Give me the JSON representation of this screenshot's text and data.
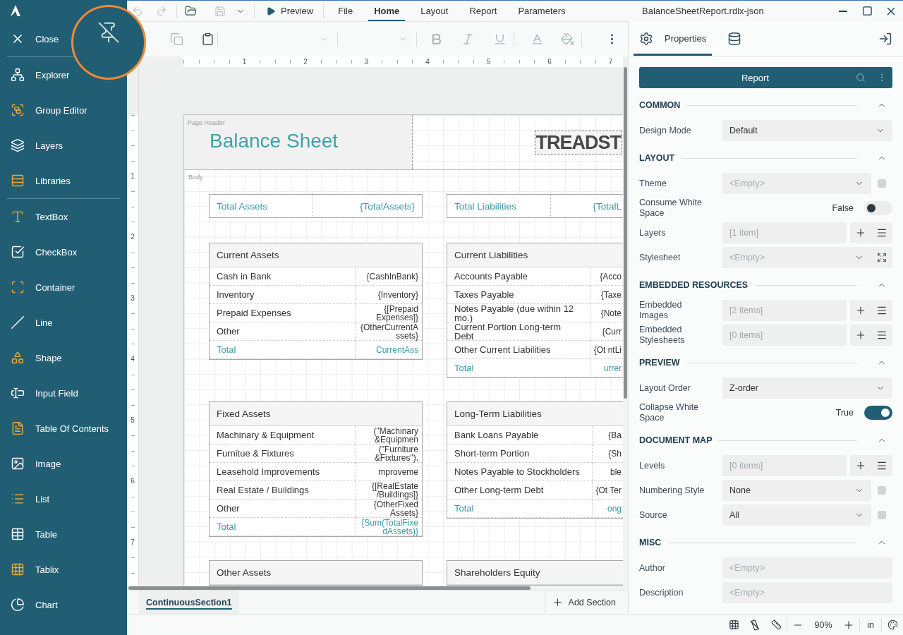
{
  "window": {
    "title": "BalanceSheetReport.rdlx-json"
  },
  "sidebar": {
    "close": "Close",
    "panels": [
      {
        "label": "Explorer"
      },
      {
        "label": "Group Editor"
      },
      {
        "label": "Layers"
      },
      {
        "label": "Libraries"
      }
    ],
    "tools": [
      {
        "label": "TextBox"
      },
      {
        "label": "CheckBox"
      },
      {
        "label": "Container"
      },
      {
        "label": "Line"
      },
      {
        "label": "Shape"
      },
      {
        "label": "Input Field"
      },
      {
        "label": "Table Of Contents"
      },
      {
        "label": "Image"
      },
      {
        "label": "List"
      },
      {
        "label": "Table"
      },
      {
        "label": "Tablix"
      },
      {
        "label": "Chart"
      }
    ]
  },
  "quick_actions": [
    {
      "disabled": true
    },
    {
      "disabled": true
    },
    {
      "disabled": false
    },
    {
      "disabled": true
    },
    {
      "disabled": false
    }
  ],
  "preview": "Preview",
  "menu_tabs": [
    {
      "label": "File",
      "selected": false
    },
    {
      "label": "Home",
      "selected": true
    },
    {
      "label": "Layout",
      "selected": false
    },
    {
      "label": "Report",
      "selected": false
    },
    {
      "label": "Parameters",
      "selected": false
    }
  ],
  "toolbar": [
    {
      "disabled": true
    },
    {
      "disabled": false
    },
    {
      "disabled": true
    },
    {
      "disabled": true
    },
    {
      "disabled": true
    },
    {
      "disabled": true
    },
    {
      "disabled": true
    },
    {
      "disabled": false
    }
  ],
  "ruler": {
    "horizontal": [
      "1",
      "2",
      "3",
      "4",
      "5",
      "6",
      "7"
    ],
    "vertical": [
      "1",
      "2",
      "3",
      "4",
      "5",
      "6",
      "7"
    ]
  },
  "report": {
    "page_header": {
      "label": "Page Header",
      "title": "Balance Sheet",
      "logo_text": "TREADST"
    },
    "body": {
      "label": "Body",
      "items": [
        {
          "kind": "summary",
          "label": "Total Assets",
          "value": "{TotalAssets}"
        },
        {
          "kind": "summary",
          "label": "Total Liabilities",
          "value": "{TotalL"
        },
        {
          "kind": "table",
          "title": "Current Assets",
          "rows": [
            {
              "kind": "item",
              "label": "Cash in Bank",
              "value": "{CashInBank}"
            },
            {
              "kind": "item",
              "label": "Inventory",
              "value": "{Inventory}"
            },
            {
              "kind": "item",
              "label": "Prepaid Expenses",
              "value": "{[Prepaid Expenses]}"
            },
            {
              "kind": "item",
              "label": "Other",
              "value": "{OtherCurrentAssets}"
            },
            {
              "kind": "total",
              "label": "Total",
              "value": "CurrentAss"
            }
          ]
        },
        {
          "kind": "table",
          "title": "Current Liabilities",
          "rows": [
            {
              "kind": "item",
              "label": "Accounts Payable",
              "value": "{Acco"
            },
            {
              "kind": "item",
              "label": "Taxes Payable",
              "value": "{Taxe"
            },
            {
              "kind": "item",
              "label": "Notes Payable (due within 12 mo.)",
              "value": "{Note"
            },
            {
              "kind": "item",
              "label": "Current Portion Long-term Debt",
              "value": "{Curr"
            },
            {
              "kind": "item",
              "label": "Other Current Liabilities",
              "value": "{Ot ntLi"
            },
            {
              "kind": "total",
              "label": "Total",
              "value": "urrer"
            }
          ]
        },
        {
          "kind": "table",
          "title": "Fixed Assets",
          "rows": [
            {
              "kind": "item",
              "label": "Machinary & Equipment",
              "value": "(\"Machinary &Equipmen"
            },
            {
              "kind": "item",
              "label": "Furnitue & Fixtures",
              "value": "(\"Furniture &Fixtures\")."
            },
            {
              "kind": "item",
              "label": "Leasehold Improvements",
              "value": "mproveme"
            },
            {
              "kind": "item",
              "label": "Real Estate / Buildings",
              "value": "{[RealEstate /Buildings]}"
            },
            {
              "kind": "item",
              "label": "Other",
              "value": "{OtherFixed Assets}"
            },
            {
              "kind": "total",
              "label": "Total",
              "value": "{Sum(TotalFixedAssets)}"
            }
          ]
        },
        {
          "kind": "table",
          "title": "Long-Term Liabilities",
          "rows": [
            {
              "kind": "item",
              "label": "Bank Loans Payable",
              "value": "{Ba"
            },
            {
              "kind": "item",
              "label": "Short-term Portion",
              "value": "{Sh"
            },
            {
              "kind": "item",
              "label": "Notes Payable to Stockholders",
              "value": "ble"
            },
            {
              "kind": "item",
              "label": "Other Long-term Debt",
              "value": "{Ot Ter"
            },
            {
              "kind": "total",
              "label": "Total",
              "value": "ong"
            }
          ]
        },
        {
          "kind": "table",
          "title": "Other Assets"
        },
        {
          "kind": "table",
          "title": "Shareholders Equity"
        }
      ]
    }
  },
  "sections": {
    "tabs": [
      {
        "label": "ContinuousSection1",
        "selected": true
      }
    ],
    "add": "Add Section"
  },
  "properties": {
    "tabs": [
      {
        "label": "Properties",
        "selected": true
      },
      {
        "selected": false
      }
    ],
    "object": "Report",
    "groups": [
      {
        "title": "COMMON",
        "expanded": true,
        "rows": [
          {
            "kind": "select",
            "label": "Design Mode",
            "value": "Default"
          }
        ]
      },
      {
        "title": "LAYOUT",
        "expanded": true,
        "rows": [
          {
            "kind": "select",
            "label": "Theme",
            "placeholder": "<Empty>",
            "accessory": {
              "kind": "indicator"
            }
          },
          {
            "kind": "toggle",
            "label": "Consume White Space",
            "value": "False",
            "on": false
          },
          {
            "kind": "collection",
            "label": "Layers",
            "value": "[1 item]"
          },
          {
            "kind": "select",
            "label": "Stylesheet",
            "placeholder": "<Empty>",
            "accessory": {
              "kind": "expand"
            }
          }
        ]
      },
      {
        "title": "EMBEDDED RESOURCES",
        "expanded": true,
        "rows": [
          {
            "kind": "collection",
            "label": "Embedded Images",
            "value": "[2 items]"
          },
          {
            "kind": "collection",
            "label": "Embedded Stylesheets",
            "value": "[0 items]"
          }
        ]
      },
      {
        "title": "PREVIEW",
        "expanded": true,
        "rows": [
          {
            "kind": "select",
            "label": "Layout Order",
            "value": "Z-order"
          },
          {
            "kind": "toggle",
            "label": "Collapse White Space",
            "value": "True",
            "on": true
          }
        ]
      },
      {
        "title": "DOCUMENT MAP",
        "expanded": true,
        "rows": [
          {
            "kind": "collection",
            "label": "Levels",
            "value": "[0 items]"
          },
          {
            "kind": "select",
            "label": "Numbering Style",
            "value": "None",
            "accessory": {
              "kind": "indicator"
            }
          },
          {
            "kind": "select",
            "label": "Source",
            "value": "All",
            "accessory": {
              "kind": "indicator"
            }
          }
        ]
      },
      {
        "title": "MISC",
        "expanded": true,
        "rows": [
          {
            "kind": "text",
            "label": "Author",
            "placeholder": "<Empty>"
          },
          {
            "kind": "text",
            "label": "Description",
            "placeholder": "<Empty>"
          }
        ]
      }
    ]
  },
  "status_bar": {
    "zoom": "90%",
    "units": "in"
  }
}
